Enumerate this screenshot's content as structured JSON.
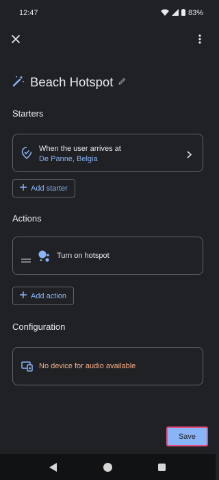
{
  "status_bar": {
    "time": "12:47",
    "battery": "83%"
  },
  "header": {
    "title": "Beach Hotspot"
  },
  "starters": {
    "section_label": "Starters",
    "item": {
      "title": "When the user arrives at",
      "location": "De Panne, Belgia"
    },
    "add_label": "Add starter"
  },
  "actions": {
    "section_label": "Actions",
    "item": {
      "label": "Turn on hotspot"
    },
    "add_label": "Add action"
  },
  "configuration": {
    "section_label": "Configuration",
    "message": "No device for audio available"
  },
  "save_label": "Save",
  "colors": {
    "accent": "#8ab4f8",
    "warning": "#f6ae88",
    "highlight": "#ea4c7e",
    "background": "#202124"
  }
}
